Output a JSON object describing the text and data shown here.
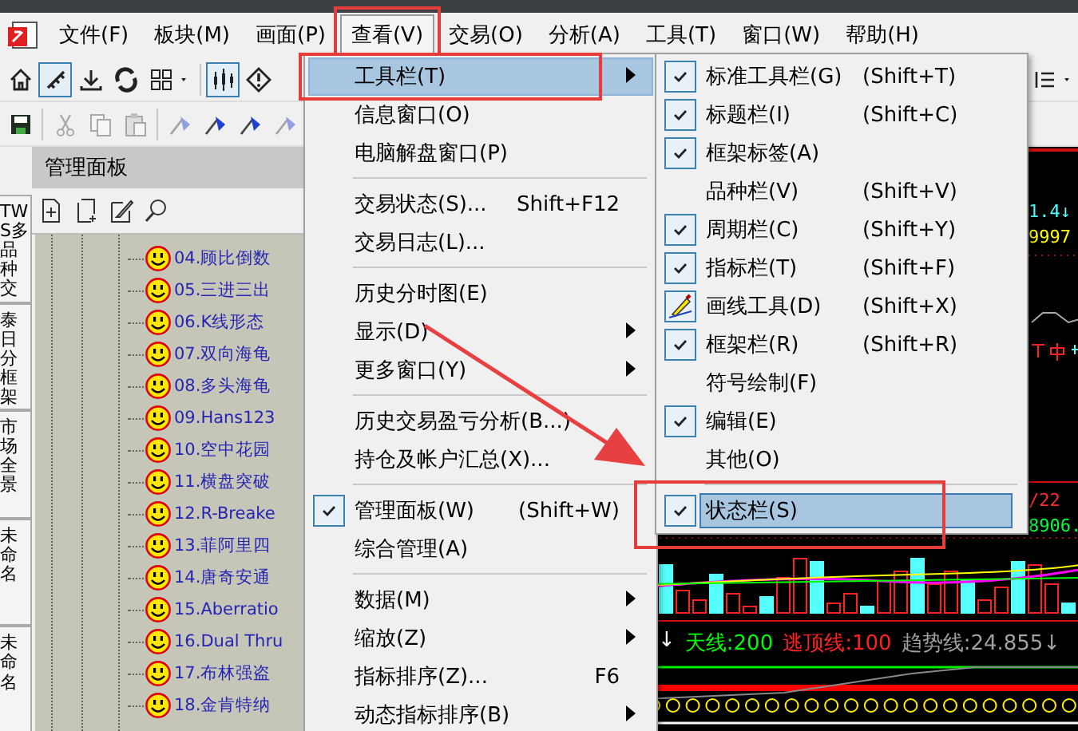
{
  "menubar": [
    {
      "label": "文件(F)",
      "selected": false,
      "highlighted": false
    },
    {
      "label": "板块(M)",
      "selected": false,
      "highlighted": false
    },
    {
      "label": "画面(P)",
      "selected": false,
      "highlighted": false
    },
    {
      "label": "查看(V)",
      "selected": true,
      "highlighted": true
    },
    {
      "label": "交易(O)",
      "selected": false,
      "highlighted": false
    },
    {
      "label": "分析(A)",
      "selected": false,
      "highlighted": false
    },
    {
      "label": "工具(T)",
      "selected": false,
      "highlighted": false
    },
    {
      "label": "窗口(W)",
      "selected": false,
      "highlighted": false
    },
    {
      "label": "帮助(H)",
      "selected": false,
      "highlighted": false
    }
  ],
  "toolbar_rows": [
    [
      {
        "kind": "home",
        "pressed": false,
        "disabled": false
      },
      {
        "kind": "ruler",
        "pressed": true,
        "disabled": false
      },
      {
        "kind": "download",
        "pressed": false,
        "disabled": false
      },
      {
        "kind": "swirl",
        "pressed": false,
        "disabled": false
      },
      {
        "kind": "grid",
        "pressed": false,
        "disabled": false
      },
      {
        "kind": "caret",
        "pressed": false,
        "disabled": false
      },
      {
        "kind": "separator"
      },
      {
        "kind": "candles",
        "pressed": true,
        "disabled": false
      },
      {
        "kind": "diamond",
        "pressed": false,
        "disabled": false
      },
      {
        "kind": "list",
        "pressed": false,
        "disabled": false
      },
      {
        "kind": "caret",
        "pressed": false,
        "disabled": false
      }
    ],
    [
      {
        "kind": "save",
        "pressed": false,
        "disabled": false
      },
      {
        "kind": "separator"
      },
      {
        "kind": "scissors",
        "pressed": false,
        "disabled": true
      },
      {
        "kind": "copy",
        "pressed": false,
        "disabled": true
      },
      {
        "kind": "paste",
        "pressed": false,
        "disabled": true
      },
      {
        "kind": "separator"
      },
      {
        "kind": "flag",
        "pressed": false,
        "disabled": true
      },
      {
        "kind": "flag",
        "pressed": false,
        "disabled": false
      },
      {
        "kind": "flag",
        "pressed": false,
        "disabled": false
      },
      {
        "kind": "flag",
        "pressed": false,
        "disabled": true
      }
    ]
  ],
  "side_tabs": [
    {
      "label": "TWS多品种交"
    },
    {
      "label": "泰日分框架"
    },
    {
      "label": "市场全景"
    },
    {
      "label": "未命名"
    },
    {
      "label": "未命名"
    }
  ],
  "panel": {
    "title": "管理面板",
    "tools": [
      {
        "kind": "new-file"
      },
      {
        "kind": "new-page"
      },
      {
        "kind": "edit"
      },
      {
        "kind": "search"
      }
    ],
    "items": [
      {
        "label": "04.顾比倒数"
      },
      {
        "label": "05.三进三出"
      },
      {
        "label": "06.K线形态"
      },
      {
        "label": "07.双向海龟"
      },
      {
        "label": "08.多头海龟"
      },
      {
        "label": "09.Hans123"
      },
      {
        "label": "10.空中花园"
      },
      {
        "label": "11.横盘突破"
      },
      {
        "label": "12.R-Breake"
      },
      {
        "label": "13.菲阿里四"
      },
      {
        "label": "14.唐奇安通"
      },
      {
        "label": "15.Aberratio"
      },
      {
        "label": "16.Dual Thru"
      },
      {
        "label": "17.布林强盗"
      },
      {
        "label": "18.金肯特纳"
      }
    ]
  },
  "chart": {
    "price": "1.4↓",
    "value": "9997",
    "date": "/22",
    "reading": "8906.",
    "indicator_labels": [
      {
        "text": "↓",
        "color": "#ffffff"
      },
      {
        "text": "天线:200",
        "color": "#00ff00"
      },
      {
        "text": "逃顶线:100",
        "color": "#ff2020"
      },
      {
        "text": "趋势线:24.855↓",
        "color": "#a0a0a0"
      }
    ]
  },
  "view_menu": {
    "items": [
      {
        "kind": "item",
        "label": "工具栏(T)",
        "submenu": true,
        "checked": false,
        "selected": true,
        "highlighted": true
      },
      {
        "kind": "item",
        "label": "信息窗口(O)",
        "submenu": false,
        "checked": false,
        "selected": false,
        "highlighted": false
      },
      {
        "kind": "item",
        "label": "电脑解盘窗口(P)",
        "submenu": false,
        "checked": false,
        "selected": false,
        "highlighted": false
      },
      {
        "kind": "separator"
      },
      {
        "kind": "item",
        "label": "交易状态(S)...",
        "shortcut": "Shift+F12",
        "submenu": false,
        "checked": false,
        "selected": false,
        "highlighted": false
      },
      {
        "kind": "item",
        "label": "交易日志(L)...",
        "submenu": false,
        "checked": false,
        "selected": false,
        "highlighted": false
      },
      {
        "kind": "separator"
      },
      {
        "kind": "item",
        "label": "历史分时图(E)",
        "submenu": false,
        "checked": false,
        "selected": false,
        "highlighted": false
      },
      {
        "kind": "item",
        "label": "显示(D)",
        "submenu": true,
        "checked": false,
        "selected": false,
        "highlighted": false
      },
      {
        "kind": "item",
        "label": "更多窗口(Y)",
        "submenu": true,
        "checked": false,
        "selected": false,
        "highlighted": false
      },
      {
        "kind": "separator"
      },
      {
        "kind": "item",
        "label": "历史交易盈亏分析(B...)",
        "submenu": false,
        "checked": false,
        "selected": false,
        "highlighted": false
      },
      {
        "kind": "item",
        "label": "持仓及帐户汇总(X)...",
        "submenu": false,
        "checked": false,
        "selected": false,
        "highlighted": false
      },
      {
        "kind": "separator"
      },
      {
        "kind": "item",
        "label": "管理面板(W)",
        "shortcut": "(Shift+W)",
        "submenu": false,
        "checked": true,
        "selected": false,
        "highlighted": false
      },
      {
        "kind": "item",
        "label": "综合管理(A)",
        "submenu": false,
        "checked": false,
        "selected": false,
        "highlighted": false
      },
      {
        "kind": "separator"
      },
      {
        "kind": "item",
        "label": "数据(M)",
        "submenu": true,
        "checked": false,
        "selected": false,
        "highlighted": false
      },
      {
        "kind": "item",
        "label": "缩放(Z)",
        "submenu": true,
        "checked": false,
        "selected": false,
        "highlighted": false
      },
      {
        "kind": "item",
        "label": "指标排序(Z)...",
        "shortcut": "F6",
        "submenu": false,
        "checked": false,
        "selected": false,
        "highlighted": false
      },
      {
        "kind": "item",
        "label": "动态指标排序(B)",
        "submenu": true,
        "checked": false,
        "selected": false,
        "highlighted": false
      }
    ]
  },
  "toolbar_submenu": {
    "items": [
      {
        "kind": "item",
        "label": "标准工具栏(G)",
        "shortcut": "(Shift+T)",
        "checked": true,
        "selected": false,
        "highlighted": false
      },
      {
        "kind": "item",
        "label": "标题栏(I)",
        "shortcut": "(Shift+C)",
        "checked": true,
        "selected": false,
        "highlighted": false
      },
      {
        "kind": "item",
        "label": "框架标签(A)",
        "checked": true,
        "selected": false,
        "highlighted": false
      },
      {
        "kind": "item",
        "label": "品种栏(V)",
        "shortcut": "(Shift+V)",
        "checked": false,
        "selected": false,
        "highlighted": false
      },
      {
        "kind": "item",
        "label": "周期栏(C)",
        "shortcut": "(Shift+Y)",
        "checked": true,
        "selected": false,
        "highlighted": false
      },
      {
        "kind": "item",
        "label": "指标栏(T)",
        "shortcut": "(Shift+F)",
        "checked": true,
        "selected": false,
        "highlighted": false
      },
      {
        "kind": "icon_item",
        "label": "画线工具(D)",
        "shortcut": "(Shift+X)",
        "checked": true,
        "selected": false,
        "highlighted": false
      },
      {
        "kind": "item",
        "label": "框架栏(R)",
        "shortcut": "(Shift+R)",
        "checked": true,
        "selected": false,
        "highlighted": false
      },
      {
        "kind": "item",
        "label": "符号绘制(F)",
        "checked": false,
        "selected": false,
        "highlighted": false
      },
      {
        "kind": "item",
        "label": "编辑(E)",
        "checked": true,
        "selected": false,
        "highlighted": false
      },
      {
        "kind": "item",
        "label": "其他(O)",
        "checked": false,
        "selected": false,
        "highlighted": false
      },
      {
        "kind": "separator"
      },
      {
        "kind": "item",
        "label": "状态栏(S)",
        "checked": true,
        "selected": true,
        "highlighted": true
      }
    ]
  },
  "annotation_arrow": true
}
